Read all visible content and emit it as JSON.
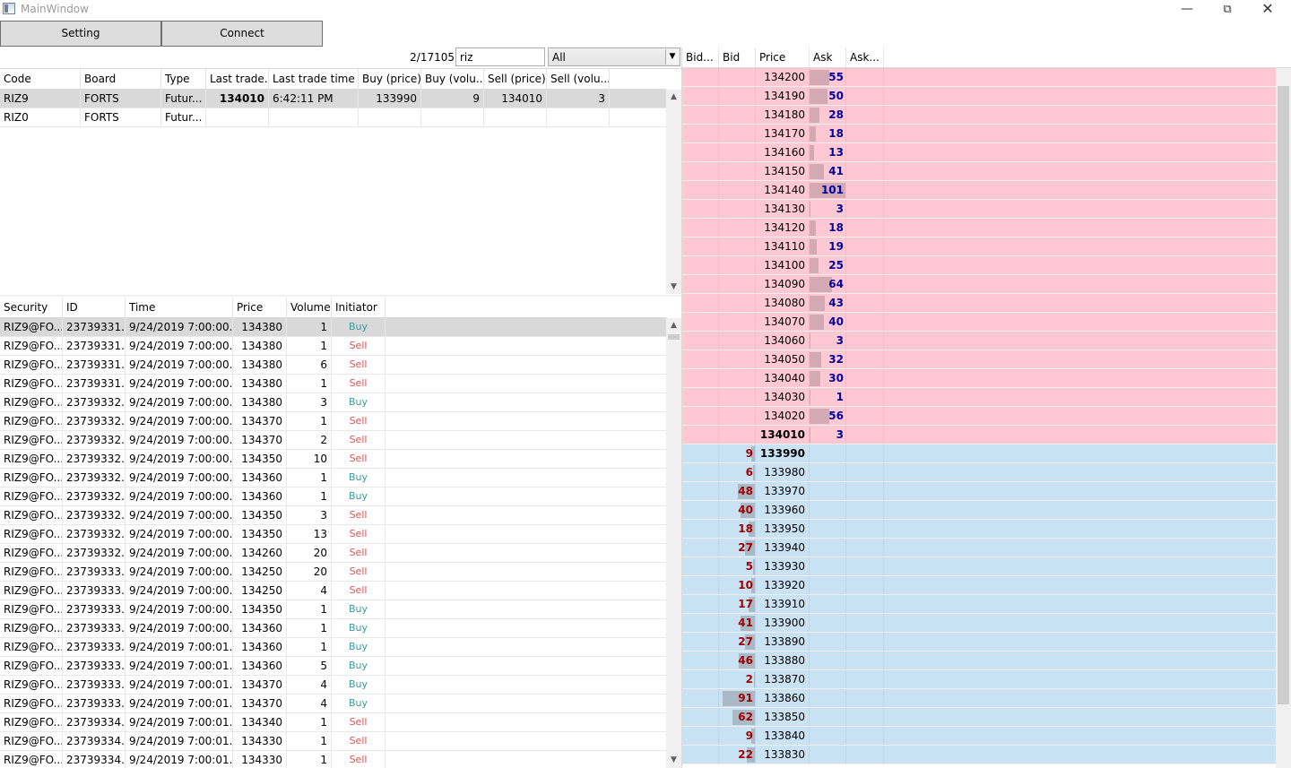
{
  "window": {
    "title": "MainWindow"
  },
  "toolbar": {
    "setting_label": "Setting",
    "connect_label": "Connect"
  },
  "filter": {
    "count": "2/17105",
    "search_value": "riz",
    "board_selected": "All"
  },
  "securities": {
    "columns": [
      "Code",
      "Board",
      "Type",
      "Last trade...",
      "Last trade time",
      "Buy (price)",
      "Buy (volu...",
      "Sell (price)",
      "Sell (volu..."
    ],
    "rows": [
      [
        "RIZ9",
        "FORTS",
        "Futur...",
        "134010",
        "6:42:11 PM",
        "133990",
        "9",
        "134010",
        "3"
      ],
      [
        "RIZ0",
        "FORTS",
        "Futur...",
        "",
        "",
        "",
        "",
        "",
        ""
      ]
    ]
  },
  "trades": {
    "columns": [
      "Security",
      "ID",
      "Time",
      "Price",
      "Volume",
      "Initiator"
    ],
    "rows": [
      [
        "RIZ9@FO...",
        "23739331...",
        "9/24/2019 7:00:00...",
        "134380",
        "1",
        "Buy"
      ],
      [
        "RIZ9@FO...",
        "23739331...",
        "9/24/2019 7:00:00...",
        "134380",
        "1",
        "Sell"
      ],
      [
        "RIZ9@FO...",
        "23739331...",
        "9/24/2019 7:00:00...",
        "134380",
        "6",
        "Sell"
      ],
      [
        "RIZ9@FO...",
        "23739331...",
        "9/24/2019 7:00:00...",
        "134380",
        "1",
        "Sell"
      ],
      [
        "RIZ9@FO...",
        "23739332...",
        "9/24/2019 7:00:00...",
        "134380",
        "3",
        "Buy"
      ],
      [
        "RIZ9@FO...",
        "23739332...",
        "9/24/2019 7:00:00...",
        "134370",
        "1",
        "Sell"
      ],
      [
        "RIZ9@FO...",
        "23739332...",
        "9/24/2019 7:00:00...",
        "134370",
        "2",
        "Sell"
      ],
      [
        "RIZ9@FO...",
        "23739332...",
        "9/24/2019 7:00:00...",
        "134350",
        "10",
        "Sell"
      ],
      [
        "RIZ9@FO...",
        "23739332...",
        "9/24/2019 7:00:00...",
        "134360",
        "1",
        "Buy"
      ],
      [
        "RIZ9@FO...",
        "23739332...",
        "9/24/2019 7:00:00...",
        "134360",
        "1",
        "Buy"
      ],
      [
        "RIZ9@FO...",
        "23739332...",
        "9/24/2019 7:00:00...",
        "134350",
        "3",
        "Sell"
      ],
      [
        "RIZ9@FO...",
        "23739332...",
        "9/24/2019 7:00:00...",
        "134350",
        "13",
        "Sell"
      ],
      [
        "RIZ9@FO...",
        "23739332...",
        "9/24/2019 7:00:00...",
        "134260",
        "20",
        "Sell"
      ],
      [
        "RIZ9@FO...",
        "23739333...",
        "9/24/2019 7:00:00...",
        "134250",
        "20",
        "Sell"
      ],
      [
        "RIZ9@FO...",
        "23739333...",
        "9/24/2019 7:00:00...",
        "134250",
        "4",
        "Sell"
      ],
      [
        "RIZ9@FO...",
        "23739333...",
        "9/24/2019 7:00:00...",
        "134350",
        "1",
        "Buy"
      ],
      [
        "RIZ9@FO...",
        "23739333...",
        "9/24/2019 7:00:00...",
        "134360",
        "1",
        "Buy"
      ],
      [
        "RIZ9@FO...",
        "23739333...",
        "9/24/2019 7:00:01...",
        "134360",
        "1",
        "Buy"
      ],
      [
        "RIZ9@FO...",
        "23739333...",
        "9/24/2019 7:00:01...",
        "134360",
        "5",
        "Buy"
      ],
      [
        "RIZ9@FO...",
        "23739333...",
        "9/24/2019 7:00:01...",
        "134370",
        "4",
        "Buy"
      ],
      [
        "RIZ9@FO...",
        "23739333...",
        "9/24/2019 7:00:01...",
        "134370",
        "4",
        "Buy"
      ],
      [
        "RIZ9@FO...",
        "23739334...",
        "9/24/2019 7:00:01...",
        "134340",
        "1",
        "Sell"
      ],
      [
        "RIZ9@FO...",
        "23739334...",
        "9/24/2019 7:00:01...",
        "134330",
        "1",
        "Sell"
      ],
      [
        "RIZ9@FO...",
        "23739334...",
        "9/24/2019 7:00:01...",
        "134330",
        "1",
        "Sell"
      ]
    ]
  },
  "orderbook": {
    "columns": [
      "Bid...",
      "Bid",
      "Price",
      "Ask",
      "Ask..."
    ],
    "colors": {
      "ask_bg": "#ffc8d2",
      "bid_bg": "#c9e3f5",
      "ask_text": "#0000a0",
      "bid_text": "#a00000",
      "ask_bar": "#d3a9b3",
      "bid_bar": "#aab9c6"
    },
    "max_volume": 101,
    "asks": [
      {
        "price": "134200",
        "vol": 55
      },
      {
        "price": "134190",
        "vol": 50
      },
      {
        "price": "134180",
        "vol": 28
      },
      {
        "price": "134170",
        "vol": 18
      },
      {
        "price": "134160",
        "vol": 13
      },
      {
        "price": "134150",
        "vol": 41
      },
      {
        "price": "134140",
        "vol": 101
      },
      {
        "price": "134130",
        "vol": 3
      },
      {
        "price": "134120",
        "vol": 18
      },
      {
        "price": "134110",
        "vol": 19
      },
      {
        "price": "134100",
        "vol": 25
      },
      {
        "price": "134090",
        "vol": 64
      },
      {
        "price": "134080",
        "vol": 43
      },
      {
        "price": "134070",
        "vol": 40
      },
      {
        "price": "134060",
        "vol": 3
      },
      {
        "price": "134050",
        "vol": 32
      },
      {
        "price": "134040",
        "vol": 30
      },
      {
        "price": "134030",
        "vol": 1
      },
      {
        "price": "134020",
        "vol": 56
      },
      {
        "price": "134010",
        "vol": 3,
        "best": true
      }
    ],
    "bids": [
      {
        "price": "133990",
        "vol": 9,
        "best": true
      },
      {
        "price": "133980",
        "vol": 6
      },
      {
        "price": "133970",
        "vol": 48
      },
      {
        "price": "133960",
        "vol": 40
      },
      {
        "price": "133950",
        "vol": 18
      },
      {
        "price": "133940",
        "vol": 27
      },
      {
        "price": "133930",
        "vol": 5
      },
      {
        "price": "133920",
        "vol": 10
      },
      {
        "price": "133910",
        "vol": 17
      },
      {
        "price": "133900",
        "vol": 41
      },
      {
        "price": "133890",
        "vol": 27
      },
      {
        "price": "133880",
        "vol": 46
      },
      {
        "price": "133870",
        "vol": 2
      },
      {
        "price": "133860",
        "vol": 91
      },
      {
        "price": "133850",
        "vol": 62
      },
      {
        "price": "133840",
        "vol": 9
      },
      {
        "price": "133830",
        "vol": 22
      }
    ]
  }
}
